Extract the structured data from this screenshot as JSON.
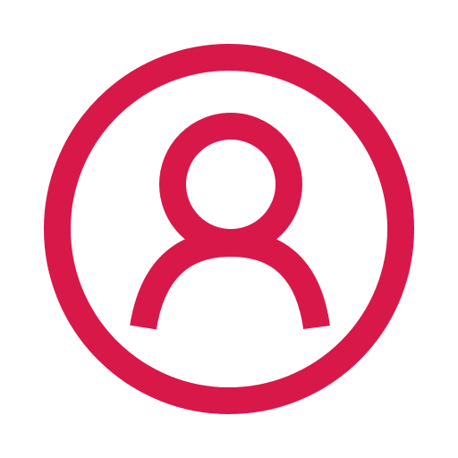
{
  "icon": {
    "name": "user-account-icon",
    "color": "#d9184a",
    "background": "#ffffff"
  }
}
